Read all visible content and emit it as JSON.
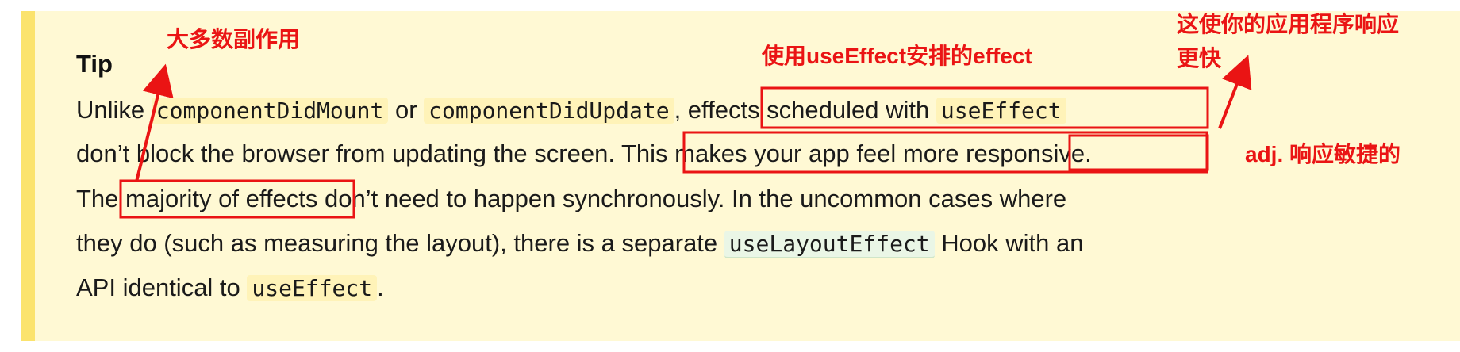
{
  "tip": {
    "title": "Tip",
    "line1": {
      "t1": "Unlike ",
      "code1": "componentDidMount",
      "t2": " or ",
      "code2": "componentDidUpdate",
      "t3": ", effects scheduled with ",
      "code3": "useEffect"
    },
    "line2": "don’t block the browser from updating the screen. This makes your app feel more responsive.",
    "line3": "The majority of effects don’t need to happen synchronously. In the uncommon cases where",
    "line4": {
      "t1": "they do (such as measuring the layout), there is a separate ",
      "code1": "useLayoutEffect",
      "t2": " Hook with an"
    },
    "line5": {
      "t1": "API identical to ",
      "code1": "useEffect",
      "t2": "."
    }
  },
  "annotations": {
    "majority": "大多数副作用",
    "scheduled": "使用useEffect安排的effect",
    "faster_line1": "这使你的应用程序响应",
    "faster_line2": "更快",
    "responsive": "adj. 响应敏捷的"
  },
  "colors": {
    "tip_background": "#fff9d4",
    "tip_bar": "#fbe36d",
    "annotation": "#ea1414",
    "inline_code_background": "#fff3b8",
    "inline_code_green_background": "#eaf6e6"
  }
}
